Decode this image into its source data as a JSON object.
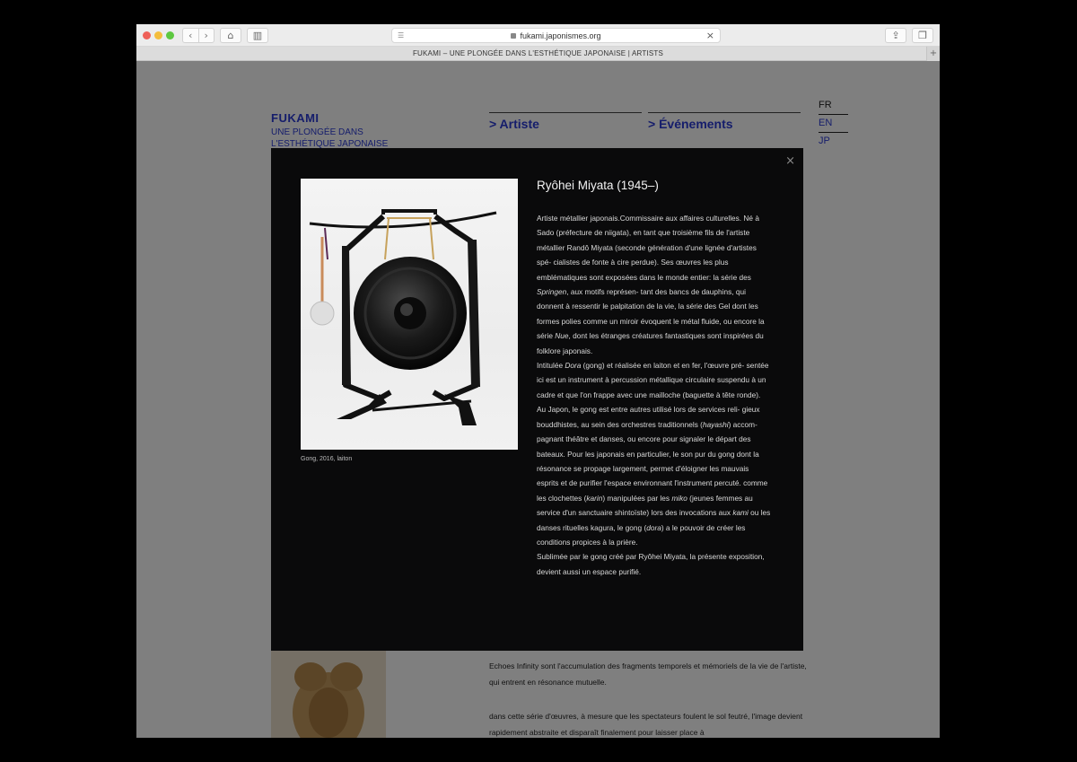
{
  "browser": {
    "url": "fukami.japonismes.org",
    "tab_title": "FUKAMI – UNE PLONGÉE DANS L'ESTHÉTIQUE JAPONAISE | ARTISTS",
    "tab_add": "+",
    "icons": {
      "back": "‹",
      "forward": "›",
      "home": "⌂",
      "sidebar": "▥",
      "reader": "☰",
      "stop": "×",
      "share": "⇪",
      "tabs": "❐"
    }
  },
  "site": {
    "brand_title": "FUKAMI",
    "brand_subtitle": "UNE PLONGÉE DANS L'ESTHÉTIQUE JAPONAISE",
    "nav": {
      "artiste": "> Artiste",
      "evenements": "> Événements"
    },
    "languages": [
      "FR",
      "EN",
      "JP"
    ],
    "bg_text_1": "Echoes Infinity sont l'accumulation des fragments temporels et mémoriels de la vie de l'artiste, qui entrent en résonance mutuelle.",
    "bg_text_2": "dans cette série d'œuvres, à mesure que les spectateurs foulent le sol feutré, l'image devient rapidement abstraite et disparaît finalement pour laisser place à"
  },
  "modal": {
    "close": "×",
    "artist_name": "Ryôhei Miyata (1945–)",
    "image_caption": "Gong, 2016, laiton",
    "image_subject": "gong-sculpture",
    "bio": {
      "p1_a": "Artiste métallier japonais.Commissaire aux affaires culturelles. Né à Sado (préfecture de niigata), en tant que troisième fils de l'artiste métallier Randô Miyata (seconde génération d'une lignée d'artistes spé- cialistes de fonte à cire perdue). Ses œuvres les plus emblématiques sont exposées dans le monde entier: la série des ",
      "p1_springen": "Springen",
      "p1_b": ", aux motifs représen- tant des bancs de dauphins, qui donnent à ressentir le palpitation de la vie, la série des Gel dont les formes polies comme un miroir évoquent le métal fluide, ou encore la série ",
      "p1_nue": "Nue",
      "p1_c": ", dont les étranges créatures fantastiques sont inspirées du folklore japonais.",
      "p2_a": "Intitulée ",
      "p2_dora": "Dora",
      "p2_b": " (gong) et réalisée en laiton et en fer, l'œuvre pré- sentée ici est un instrument à percussion métallique circulaire suspendu à un cadre et que l'on frappe avec une mailloche (baguette à tête ronde).",
      "p3_a": "Au Japon, le gong est entre autres utilisé lors de services reli- gieux bouddhistes, au sein des orchestres traditionnels (",
      "p3_hayashi": "hayashi",
      "p3_b": ") accom- pagnant théâtre et danses, ou encore pour signaler le départ des bateaux. Pour les japonais en particulier, le son pur du gong dont la résonance se propage largement, permet d'éloigner les mauvais esprits et de purifier l'espace environnant l'instrument percuté. comme les clochettes (",
      "p3_karin": "karin",
      "p3_c": ") manipulées par les ",
      "p3_miko": "miko",
      "p3_d": " (jeunes femmes au service d'un sanctuaire shintoïste) lors des invocations aux ",
      "p3_kami": "kami",
      "p3_e": " ou les danses rituelles kagura, le gong (",
      "p3_dora": "dora",
      "p3_f": ") a le pouvoir de créer les conditions propices à la prière.",
      "p4": "Sublimée par le gong créé par Ryôhei Miyata, la présente exposition, devient aussi un espace purifié."
    }
  }
}
